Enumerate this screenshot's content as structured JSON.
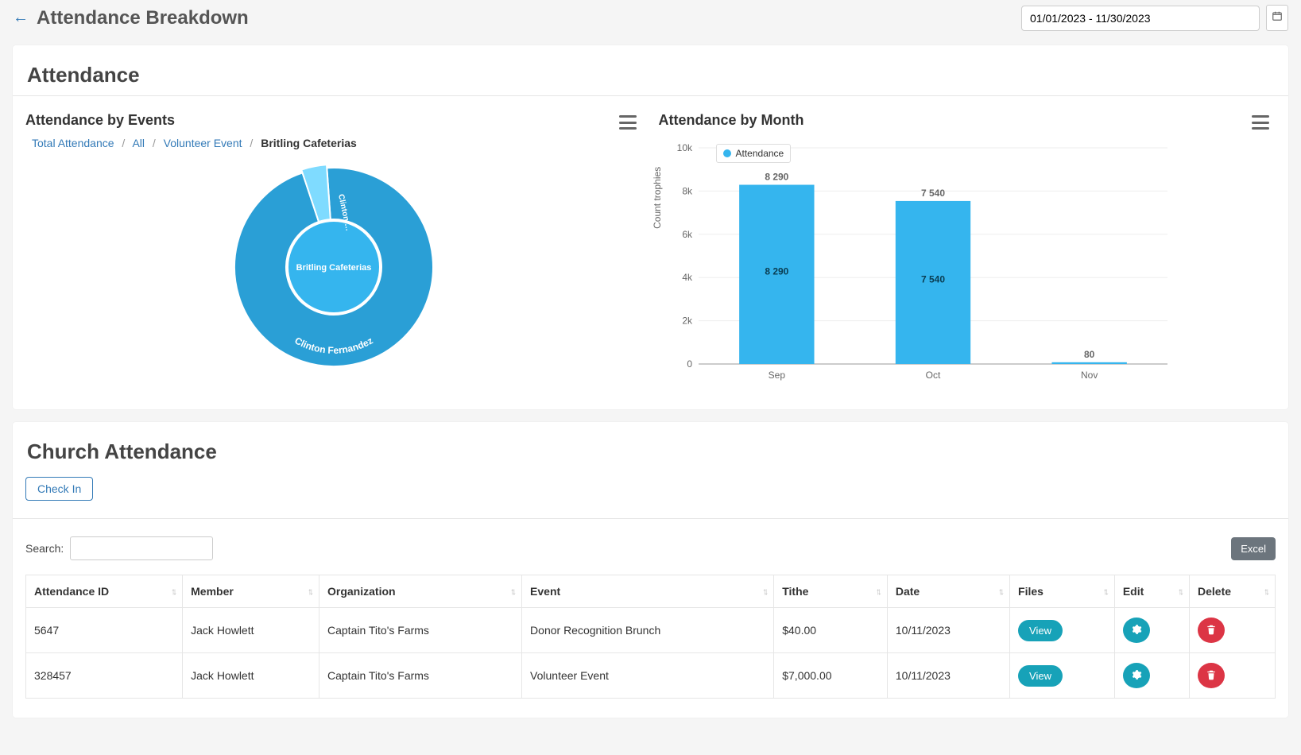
{
  "page": {
    "title": "Attendance Breakdown",
    "date_range": "01/01/2023 - 11/30/2023"
  },
  "attendance_section": {
    "title": "Attendance",
    "by_events": {
      "title": "Attendance by Events",
      "breadcrumb": [
        {
          "label": "Total Attendance",
          "link": true
        },
        {
          "label": "All",
          "link": true
        },
        {
          "label": "Volunteer Event",
          "link": true
        },
        {
          "label": "Britling Cafeterias",
          "link": false
        }
      ],
      "inner_label": "Britling Cafeterias",
      "outer_label": "Clinton Fernandez",
      "slice_label": "Clinton …"
    },
    "by_month": {
      "title": "Attendance by Month",
      "y_axis_title": "Count trophies",
      "legend": "Attendance"
    }
  },
  "church_section": {
    "title": "Church Attendance",
    "check_in": "Check In",
    "search_label": "Search:",
    "excel_label": "Excel",
    "columns": [
      "Attendance ID",
      "Member",
      "Organization",
      "Event",
      "Tithe",
      "Date",
      "Files",
      "Edit",
      "Delete"
    ],
    "view_label": "View",
    "rows": [
      {
        "id": "5647",
        "member": "Jack Howlett",
        "org": "Captain Tito's Farms",
        "event": "Donor Recognition Brunch",
        "tithe": "$40.00",
        "date": "10/11/2023"
      },
      {
        "id": "328457",
        "member": "Jack Howlett",
        "org": "Captain Tito's Farms",
        "event": "Volunteer Event",
        "tithe": "$7,000.00",
        "date": "10/11/2023"
      }
    ]
  },
  "chart_data": [
    {
      "type": "pie",
      "title": "Attendance by Events",
      "levels": "sunburst (inner: organization, outer: member)",
      "series": [
        {
          "name": "Britling Cafeterias",
          "ring": "inner",
          "value": 100
        },
        {
          "name": "Clinton Fernandez",
          "ring": "outer",
          "value": 96
        },
        {
          "name": "Clinton …",
          "ring": "outer",
          "value": 4
        }
      ]
    },
    {
      "type": "bar",
      "title": "Attendance by Month",
      "ylabel": "Count trophies",
      "ylim": [
        0,
        10000
      ],
      "y_ticks": [
        "0",
        "2k",
        "4k",
        "6k",
        "8k",
        "10k"
      ],
      "categories": [
        "Sep",
        "Oct",
        "Nov"
      ],
      "series": [
        {
          "name": "Attendance",
          "values": [
            8290,
            7540,
            80
          ]
        }
      ]
    }
  ]
}
